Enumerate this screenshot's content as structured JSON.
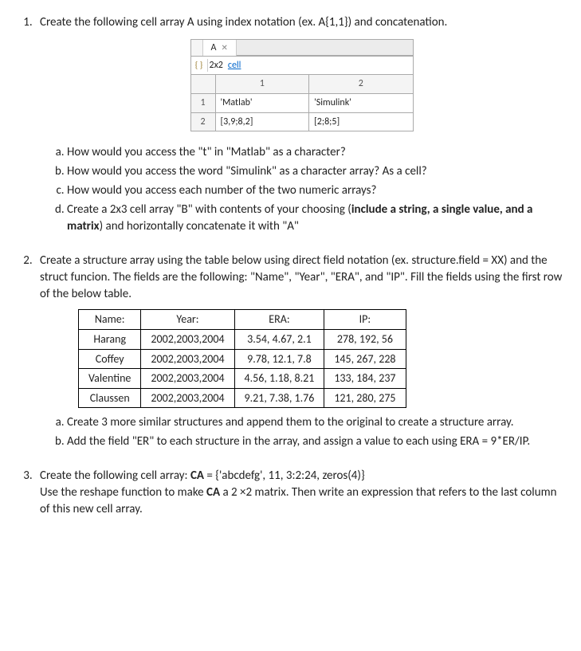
{
  "q1": {
    "text": "Create the following cell array A using index notation (ex. A{1,1}) and concatenation.",
    "widget": {
      "tab": "A",
      "dim_prefix": "2x2 ",
      "dim_link": "cell",
      "brace_icon": "{ }",
      "colheaders": [
        "1",
        "2"
      ],
      "rowheaders": [
        "1",
        "2"
      ],
      "cells": [
        [
          "'Matlab'",
          "'Simulink'"
        ],
        [
          "[3,9;8,2]",
          "[2;8;5]"
        ]
      ]
    },
    "a": "How would you access the \"t\" in \"Matlab\" as a character?",
    "b": "How would you access the word \"Simulink\" as a character array? As a cell?",
    "c": "How would you access each number of the two numeric arrays?",
    "d_pre": "Create a 2x3 cell array \"B\" with contents of your choosing (",
    "d_bold": "include a string, a single value, and a matrix",
    "d_post": ") and horizontally concatenate it with \"A\""
  },
  "q2": {
    "text": "Create a structure array using the table below using direct field notation (ex. structure.field = XX) and the struct funcion. The fields are the following: \"Name\", \"Year\", \"ERA\", and \"IP\". Fill the fields using the first row of the below table.",
    "headers": [
      "Name:",
      "Year:",
      "ERA:",
      "IP:"
    ],
    "rows": [
      [
        "Harang",
        "2002,2003,2004",
        "3.54, 4.67, 2.1",
        "278, 192, 56"
      ],
      [
        "Coffey",
        "2002,2003,2004",
        "9.78, 12.1, 7.8",
        "145, 267, 228"
      ],
      [
        "Valentine",
        "2002,2003,2004",
        "4.56, 1.18, 8.21",
        "133, 184, 237"
      ],
      [
        "Claussen",
        "2002,2003,2004",
        "9.21, 7.38, 1.76",
        "121, 280, 275"
      ]
    ],
    "a": "Create 3 more similar structures and append them to the original to create a structure array.",
    "b": "Add the field \"ER\" to each structure in the array, and assign a value to each using ERA = 9*ER/IP."
  },
  "q3": {
    "line1_pre": "Create the following cell array: ",
    "line1_bold": "CA",
    "line1_post": " = {'abcdefg', 11, 3:2:24, zeros(4)}",
    "line2_pre": "Use the reshape function to make ",
    "line2_bold": "CA",
    "line2_post": " a 2 ×2 matrix. Then write an expression that refers to the last column of this new cell array."
  }
}
